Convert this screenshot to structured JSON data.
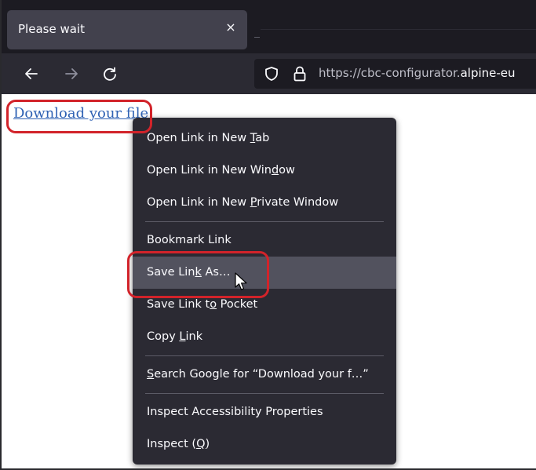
{
  "tab": {
    "title": "Please wait",
    "close_glyph": "×"
  },
  "navbar": {
    "back_icon": "arrow-left-icon",
    "forward_icon": "arrow-right-icon",
    "reload_icon": "reload-icon",
    "url_prefix": "https://cbc-configurator.",
    "url_domain": "alpine-eu"
  },
  "page": {
    "link_text": "Download your file"
  },
  "context_menu": {
    "items": [
      {
        "before": "Open Link in New ",
        "key": "T",
        "after": "ab"
      },
      {
        "before": "Open Link in New Win",
        "key": "d",
        "after": "ow"
      },
      {
        "before": "Open Link in New ",
        "key": "P",
        "after": "rivate Window"
      },
      {
        "before": "Bookmark Link",
        "key": "",
        "after": ""
      },
      {
        "before": "Save Lin",
        "key": "k",
        "after": " As…"
      },
      {
        "before": "Save Link t",
        "key": "o",
        "after": " Pocket"
      },
      {
        "before": "Copy ",
        "key": "L",
        "after": "ink"
      },
      {
        "before": "",
        "key": "S",
        "after": "earch Google for “Download your f…”"
      },
      {
        "before": "Inspect Accessibility Properties",
        "key": "",
        "after": ""
      },
      {
        "before": "Inspect (",
        "key": "Q",
        "after": ")"
      }
    ]
  },
  "colors": {
    "tabstrip_bg": "#1c1b22",
    "navbar_bg": "#2b2a33",
    "menu_bg": "#2b2a33",
    "menu_hover": "#52525e",
    "highlight": "#d2232a",
    "link": "#2f62b4"
  }
}
